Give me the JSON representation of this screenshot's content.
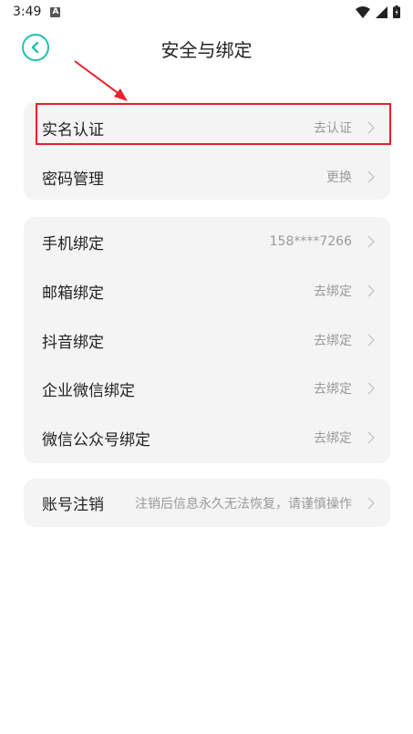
{
  "status_bar": {
    "time": "3:49",
    "notification_icon": "a-square-icon",
    "signal_icons": [
      "wifi-icon",
      "cell-signal-icon",
      "battery-icon"
    ]
  },
  "header": {
    "title": "安全与绑定",
    "back_icon": "back-arrow-icon"
  },
  "security_card": {
    "rows": [
      {
        "label": "实名认证",
        "value": "去认证"
      },
      {
        "label": "密码管理",
        "value": "更换"
      }
    ]
  },
  "binding_card": {
    "rows": [
      {
        "label": "手机绑定",
        "value": "158****7266"
      },
      {
        "label": "邮箱绑定",
        "value": "去绑定"
      },
      {
        "label": "抖音绑定",
        "value": "去绑定"
      },
      {
        "label": "企业微信绑定",
        "value": "去绑定"
      },
      {
        "label": "微信公众号绑定",
        "value": "去绑定"
      }
    ]
  },
  "account_card": {
    "label": "账号注销",
    "value": "注销后信息永久无法恢复，请谨慎操作"
  },
  "colors": {
    "accent": "#1fc2b0",
    "highlight": "#e8202a",
    "card_bg": "#f4f4f4"
  }
}
